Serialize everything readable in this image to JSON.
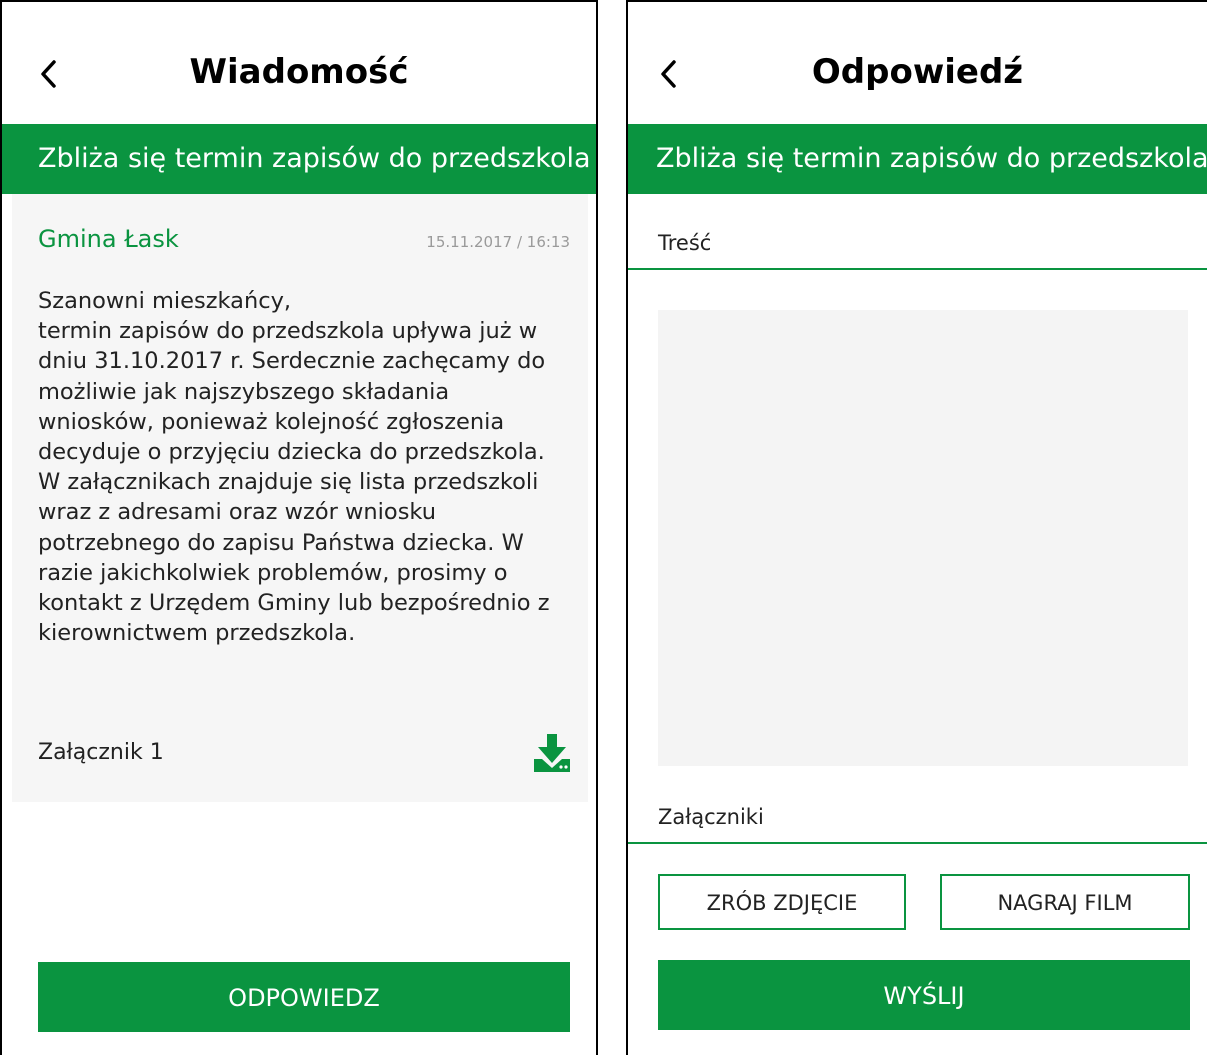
{
  "message_screen": {
    "title": "Wiadomość",
    "subject": "Zbliża się termin zapisów do przedszkola",
    "sender": "Gmina Łask",
    "date": "15.11.2017 / 16:13",
    "body": {
      "greeting": "Szanowni mieszkańcy,",
      "text": "termin zapisów do przedszkola upływa już w dniu 31.10.2017 r. Serdecznie zachęcamy do możliwie jak najszybszego składania wniosków, ponieważ kolejność zgłoszenia decyduje o przyjęciu dziecka do przedszkola. W załącznikach znajduje się lista przedszkoli wraz z adresami oraz wzór wniosku potrzebnego do zapisu Państwa dziecka. W razie jakichkolwiek problemów, prosimy o kontakt z Urzędem Gminy lub bezpośrednio z kierownictwem przedszkola."
    },
    "attachment_label": "Załącznik 1",
    "reply_button": "ODPOWIEDZ"
  },
  "reply_screen": {
    "title": "Odpowiedź",
    "subject": "Zbliża się termin zapisów do przedszkola",
    "content_label": "Treść",
    "content_value": "",
    "attachments_label": "Załączniki",
    "photo_button": "ZRÓB ZDJĘCIE",
    "video_button": "NAGRAJ FILM",
    "send_button": "WYŚLIJ"
  },
  "icons": {
    "back": "chevron-left-icon",
    "download": "download-icon"
  },
  "colors": {
    "accent": "#0a9440",
    "card_background": "#f6f6f6",
    "date_text": "#9a9a9a"
  }
}
